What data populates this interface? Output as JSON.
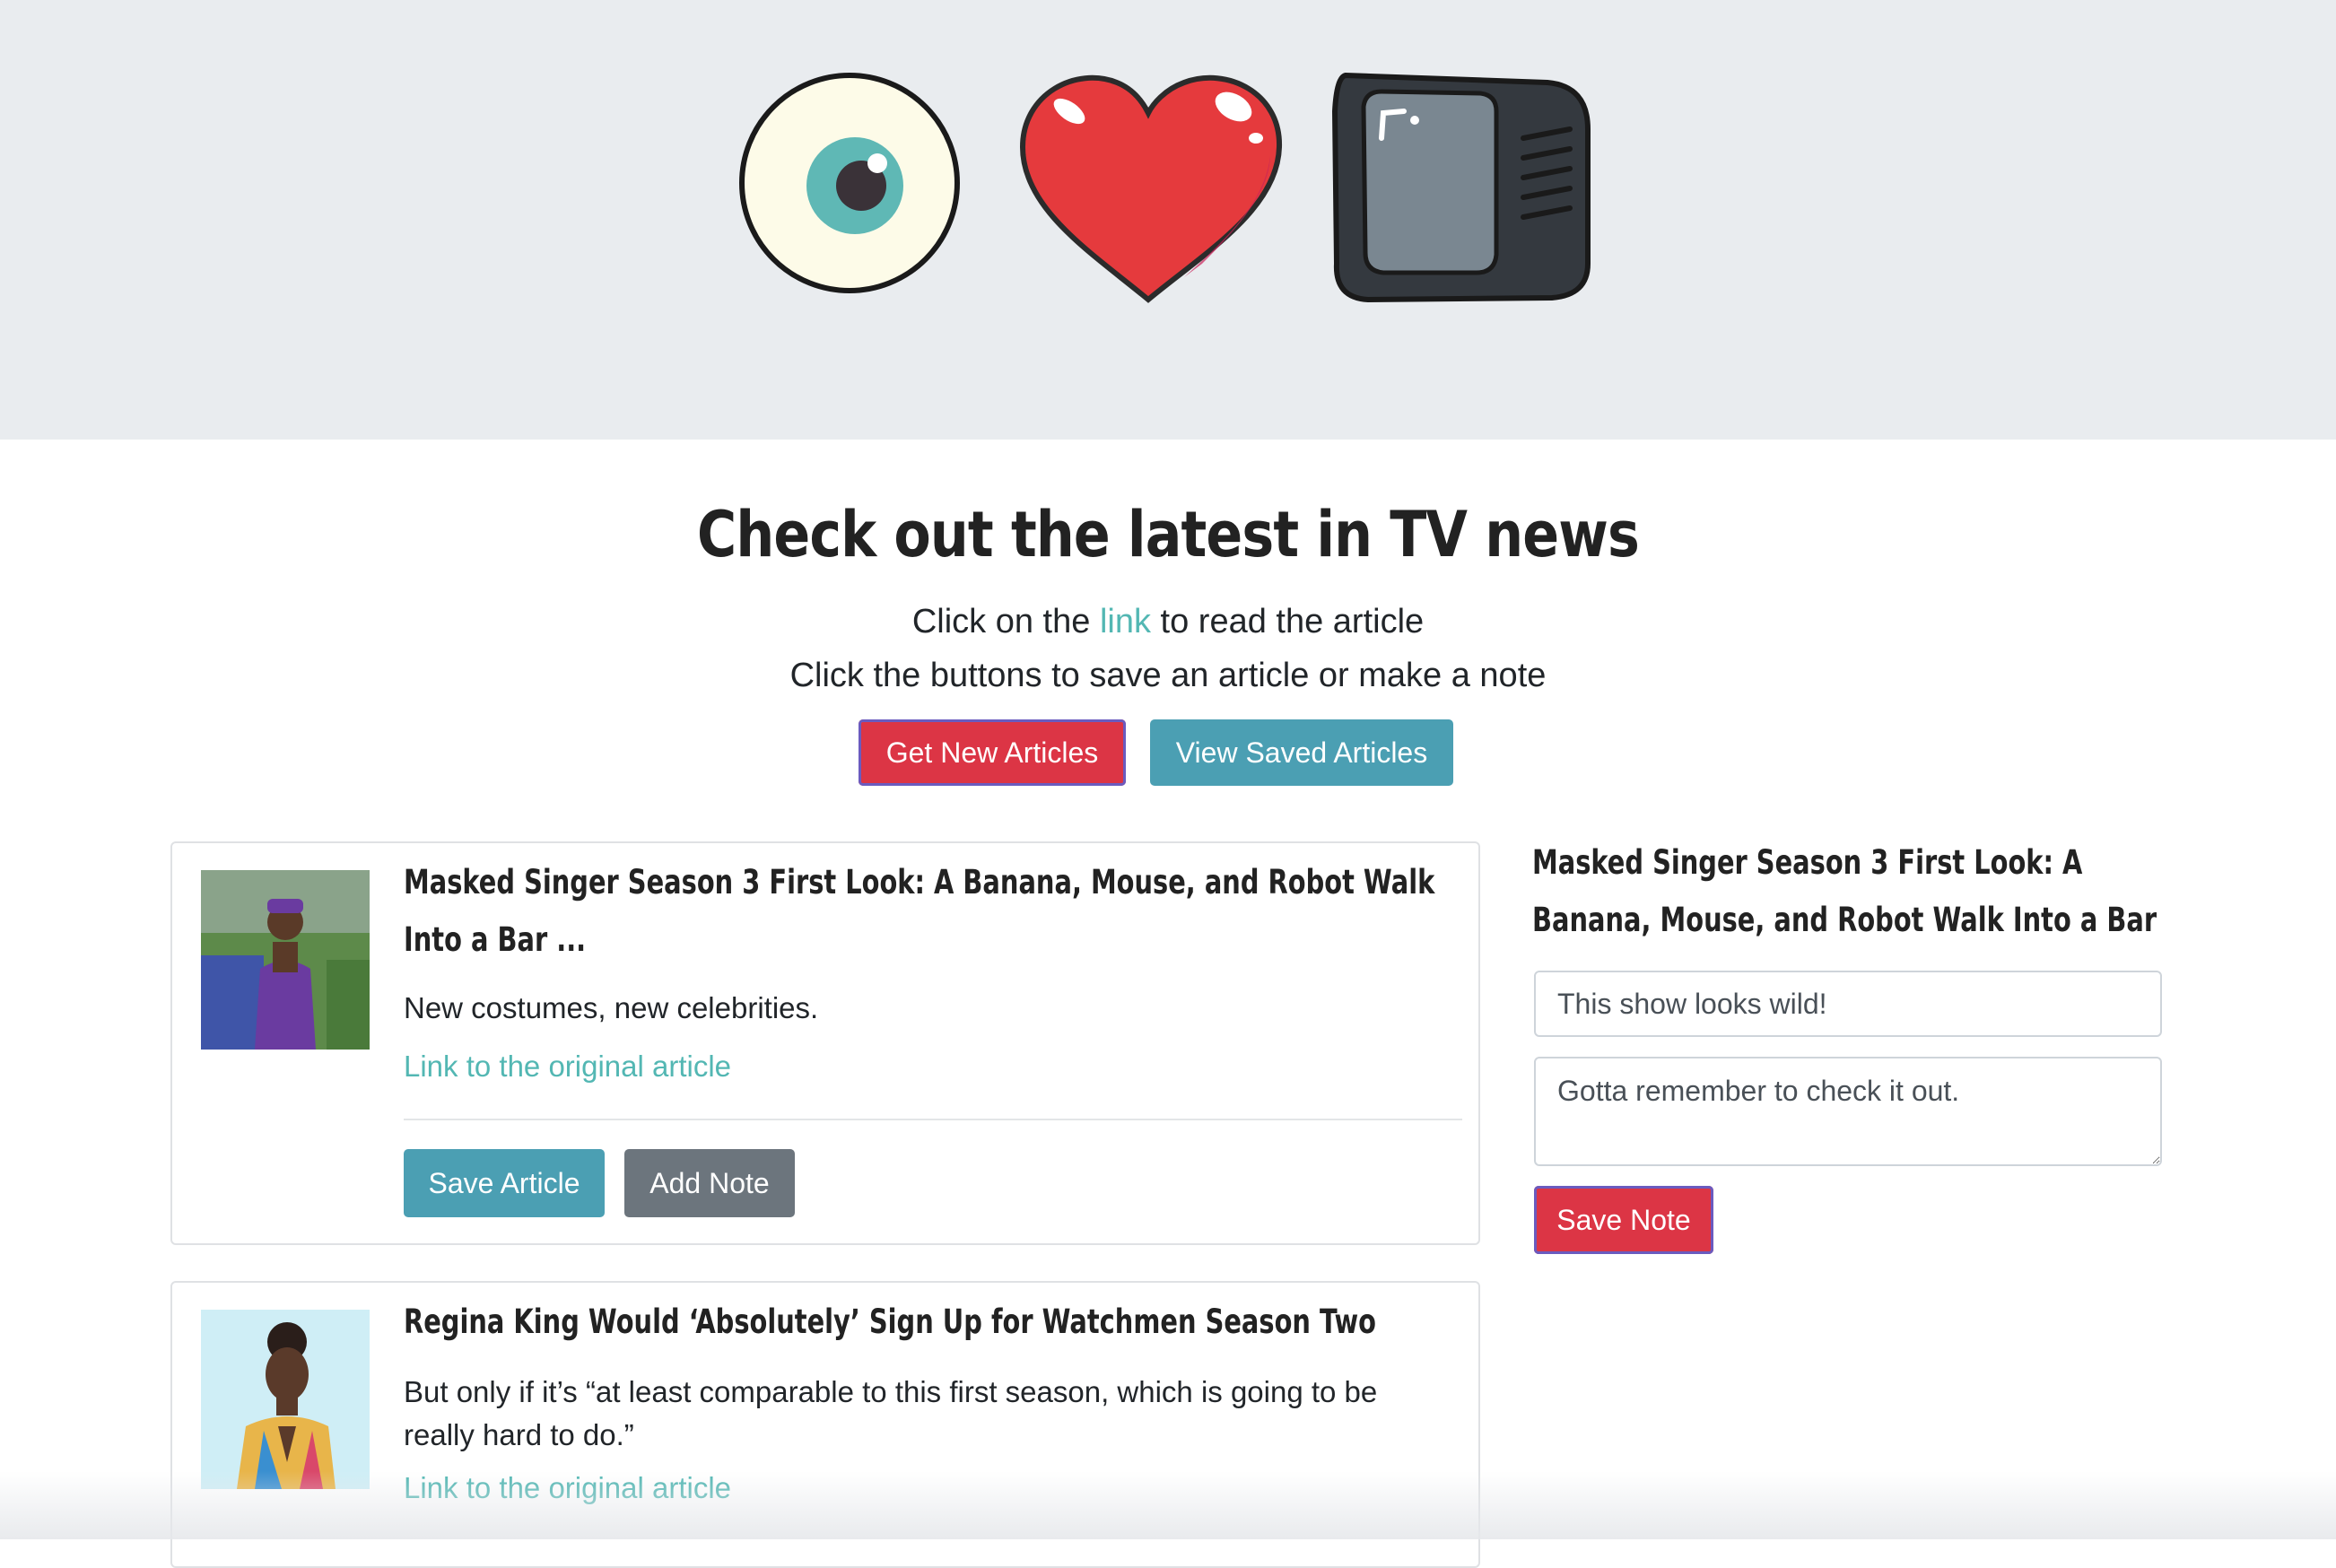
{
  "header": {
    "logo_icons": [
      "eye-icon",
      "heart-icon",
      "tv-icon"
    ]
  },
  "hero": {
    "title": "Check out the latest in TV news",
    "line1_before": "Click on the",
    "line1_link": "link",
    "line1_after": "to read the article",
    "line2": "Click the buttons to save an article or make a note"
  },
  "actions": {
    "get_new": "Get New Articles",
    "view_saved": "View Saved Articles"
  },
  "articles": [
    {
      "title": "Masked Singer Season 3 First Look: A Banana, Mouse, and Robot Walk Into a Bar ...",
      "description": "New costumes, new celebrities.",
      "link_text": "Link to the original article",
      "save_label": "Save Article",
      "note_label": "Add Note"
    },
    {
      "title": "Regina King Would ‘Absolutely’ Sign Up for Watchmen Season Two",
      "description": "But only if it’s “at least comparable to this first season, which is going to be really hard to do.”",
      "link_text": "Link to the original article"
    }
  ],
  "note_panel": {
    "title": "Masked Singer Season 3 First Look: A Banana, Mouse, and Robot Walk Into a Bar ...",
    "title_value": "This show looks wild!",
    "body_value": "Gotta remember to check it out.",
    "save_label": "Save Note"
  },
  "colors": {
    "danger": "#dc3545",
    "info": "#4b9fb3",
    "secondary": "#6c757d",
    "link": "#53b7b3",
    "jumbotron": "#e9ecef"
  }
}
